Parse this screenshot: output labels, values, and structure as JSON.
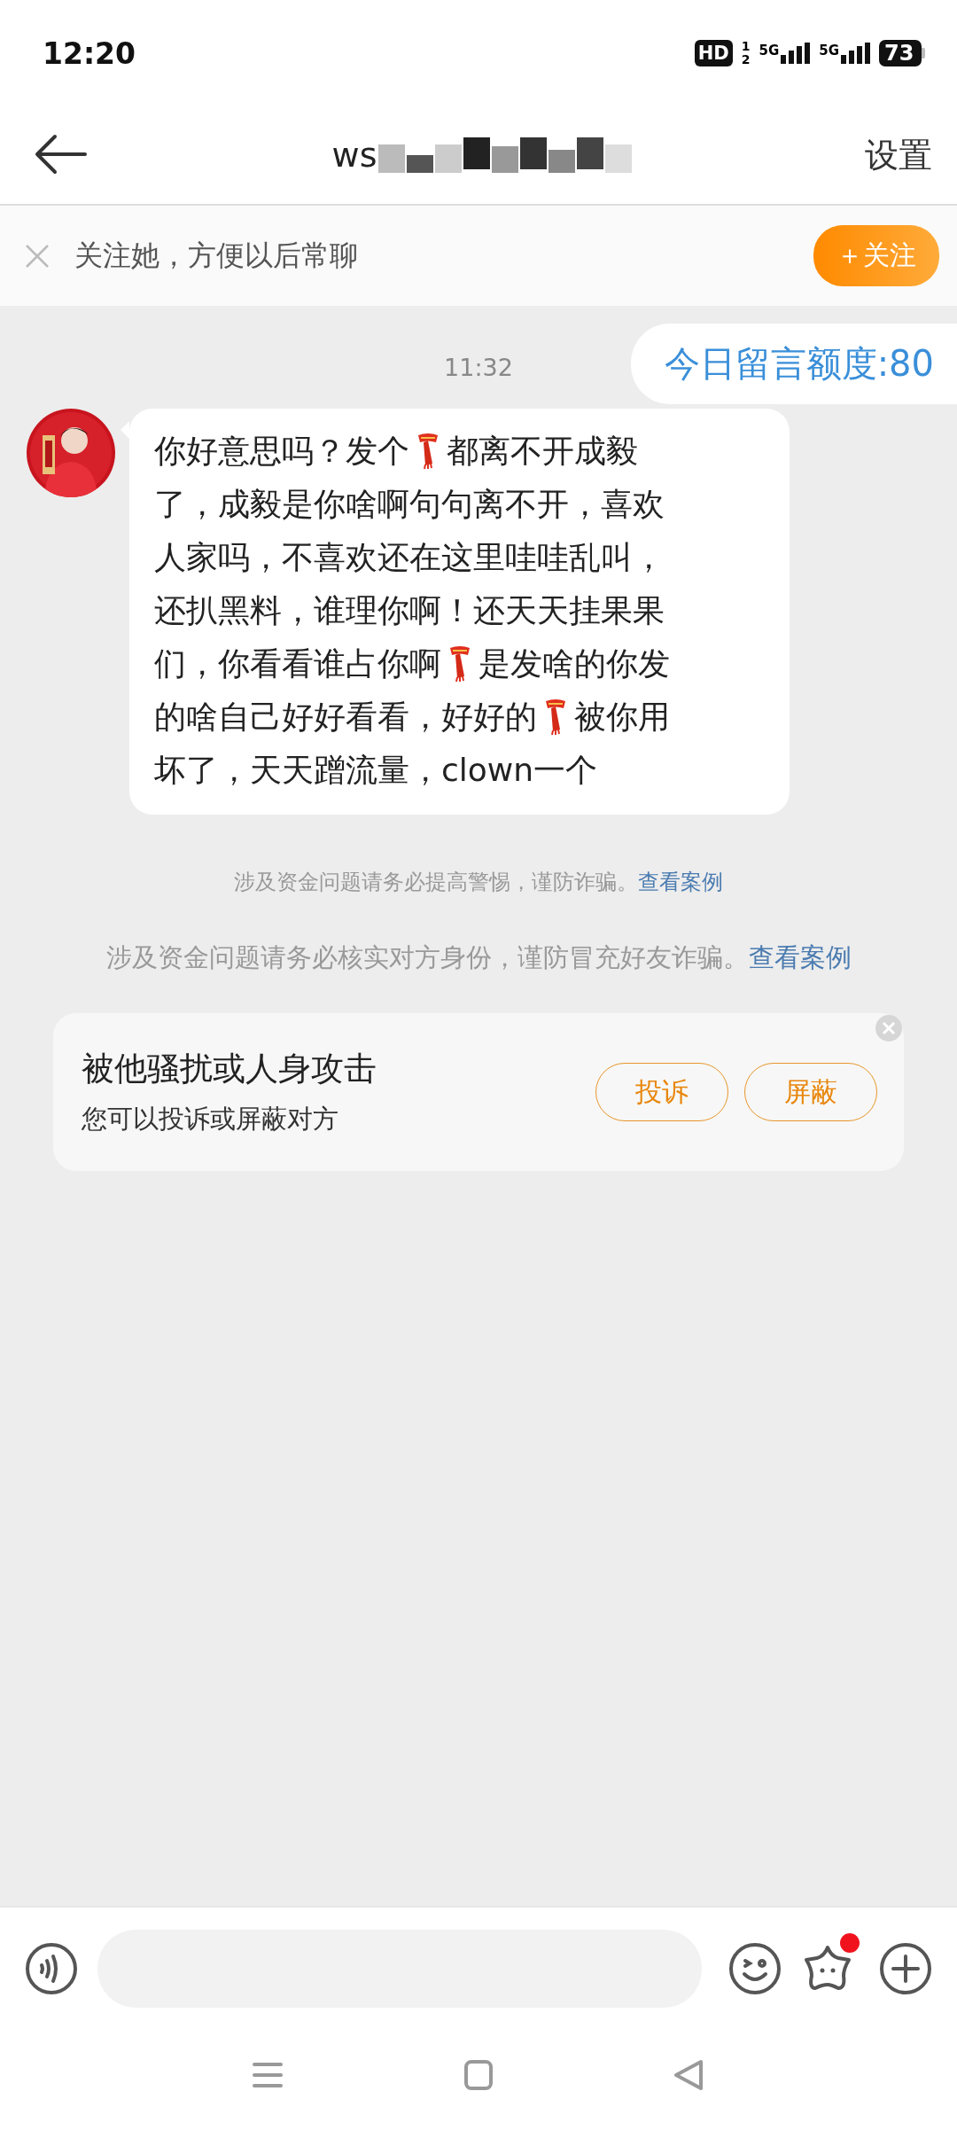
{
  "status_bar": {
    "time": "12:20",
    "hd": "HD",
    "sim_labels": [
      "1",
      "2"
    ],
    "networks": [
      "5G",
      "5G"
    ],
    "battery": "73"
  },
  "header": {
    "title": "ws",
    "action": "设置"
  },
  "follow_bar": {
    "text": "关注她，方便以后常聊",
    "button": "＋关注"
  },
  "chat": {
    "time": "11:32",
    "outgoing": "今日留言额度:80",
    "incoming": [
      [
        {
          "kind": "text",
          "text": "你好意思吗？发个"
        },
        {
          "kind": "scarf"
        },
        {
          "kind": "text",
          "text": "都离不开成毅"
        }
      ],
      [
        {
          "kind": "text",
          "text": "了，成毅是你啥啊句句离不开，喜欢"
        }
      ],
      [
        {
          "kind": "text",
          "text": "人家吗，不喜欢还在这里哇哇乱叫，"
        }
      ],
      [
        {
          "kind": "text",
          "text": "还扒黑料，谁理你啊！还天天挂果果"
        }
      ],
      [
        {
          "kind": "text",
          "text": "们，你看看谁占你啊"
        },
        {
          "kind": "scarf"
        },
        {
          "kind": "text",
          "text": "是发啥的你发"
        }
      ],
      [
        {
          "kind": "text",
          "text": "的啥自己好好看看，好好的"
        },
        {
          "kind": "scarf"
        },
        {
          "kind": "text",
          "text": "被你用"
        }
      ],
      [
        {
          "kind": "text",
          "text": "坏了，天天蹭流量，clown一个"
        }
      ]
    ]
  },
  "notices": [
    {
      "kind": "small",
      "text": "涉及资金问题请务必提高警惕，谨防诈骗。",
      "link": "查看案例"
    },
    {
      "kind": "large",
      "text": "涉及资金问题请务必核实对方身份，谨防冒充好友诈骗。",
      "link": "查看案例"
    }
  ],
  "report_card": {
    "title": "被他骚扰或人身攻击",
    "subtitle": "您可以投诉或屏蔽对方",
    "buttons": [
      "投诉",
      "屏蔽"
    ]
  },
  "input_bar": {
    "sticker_dot": true
  }
}
